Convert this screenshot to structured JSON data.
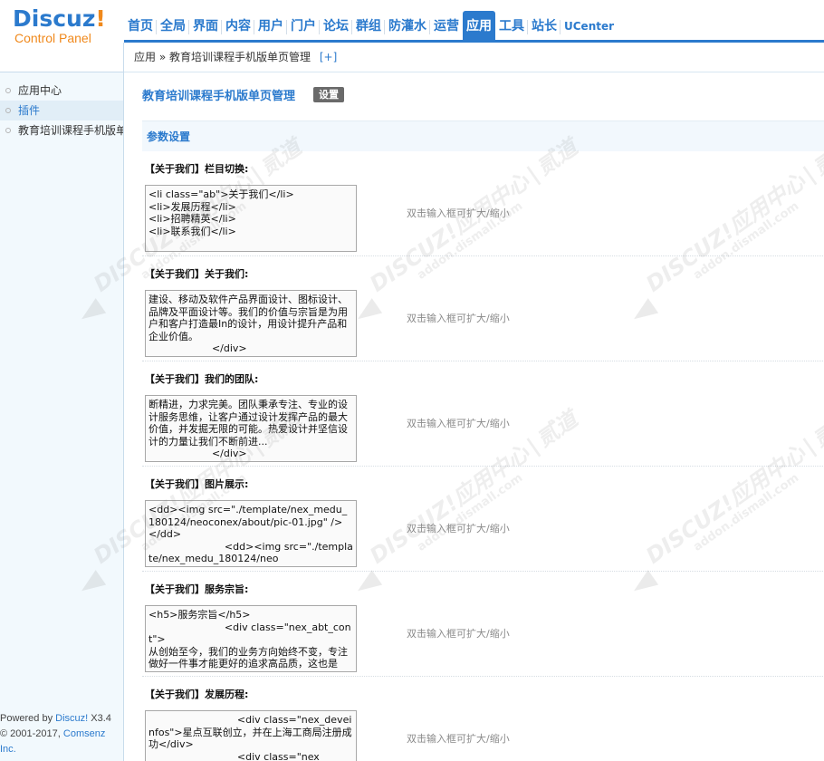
{
  "header": {
    "logo_main": "Discuz",
    "logo_bang": "!",
    "logo_sub": "Control Panel",
    "nav": [
      {
        "label": "首页"
      },
      {
        "label": "全局"
      },
      {
        "label": "界面"
      },
      {
        "label": "内容"
      },
      {
        "label": "用户"
      },
      {
        "label": "门户"
      },
      {
        "label": "论坛"
      },
      {
        "label": "群组"
      },
      {
        "label": "防灌水"
      },
      {
        "label": "运营"
      },
      {
        "label": "应用",
        "active": true
      },
      {
        "label": "工具"
      },
      {
        "label": "站长"
      },
      {
        "label": "UCenter"
      }
    ]
  },
  "breadcrumb": {
    "root": "应用",
    "sep": "»",
    "current": "教育培训课程手机版单页管理",
    "add": "[+]"
  },
  "sidebar": {
    "items": [
      {
        "label": "应用中心"
      },
      {
        "label": "插件",
        "active": true
      },
      {
        "label": "教育培训课程手机版单页管理"
      }
    ],
    "footer_prefix": "Powered by ",
    "footer_brand": "Discuz!",
    "footer_version": " X3.4",
    "footer_copy": "© 2001-2017, ",
    "footer_company": "Comsenz Inc."
  },
  "main": {
    "title": "教育培训课程手机版单页管理",
    "settings_label": "设置",
    "section_title": "参数设置",
    "hint": "双击输入框可扩大/缩小",
    "settings": [
      {
        "label": "【关于我们】栏目切换:",
        "value": "<li class=\"ab\">关于我们</li>\n<li>发展历程</li>\n<li>招聘精英</li>\n<li>联系我们</li>"
      },
      {
        "label": "【关于我们】关于我们:",
        "value": "建设、移动及软件产品界面设计、图标设计、品牌及平面设计等。我们的价值与宗旨是为用户和客户打造最In的设计，用设计提升产品和企业价值。\n                    </div>"
      },
      {
        "label": "【关于我们】我们的团队:",
        "value": "断精进，力求完美。团队秉承专注、专业的设计服务思维，让客户通过设计发挥产品的最大价值，并发掘无限的可能。热爱设计并坚信设计的力量让我们不断前进...\n                    </div>"
      },
      {
        "label": "【关于我们】图片展示:",
        "value": "<dd><img src=\"./template/nex_medu_180124/neoconex/about/pic-01.jpg\" /></dd>\n                        <dd><img src=\"./template/nex_medu_180124/neo"
      },
      {
        "label": "【关于我们】服务宗旨:",
        "value": "<h5>服务宗旨</h5>\n                        <div class=\"nex_abt_cont\">\n从创始至今，我们的业务方向始终不变，专注做好一件事才能更好的追求高品质，这也是"
      },
      {
        "label": "【关于我们】发展历程:",
        "value": "                            <div class=\"nex_deveinfos\">星点互联创立，并在上海工商局注册成功</div>\n                            <div class=\"nex"
      }
    ]
  },
  "watermark": {
    "big": "DISCUZ!应用中心",
    "sep": "|",
    "brand": "贰道",
    "url": "addon.dismall.com"
  }
}
